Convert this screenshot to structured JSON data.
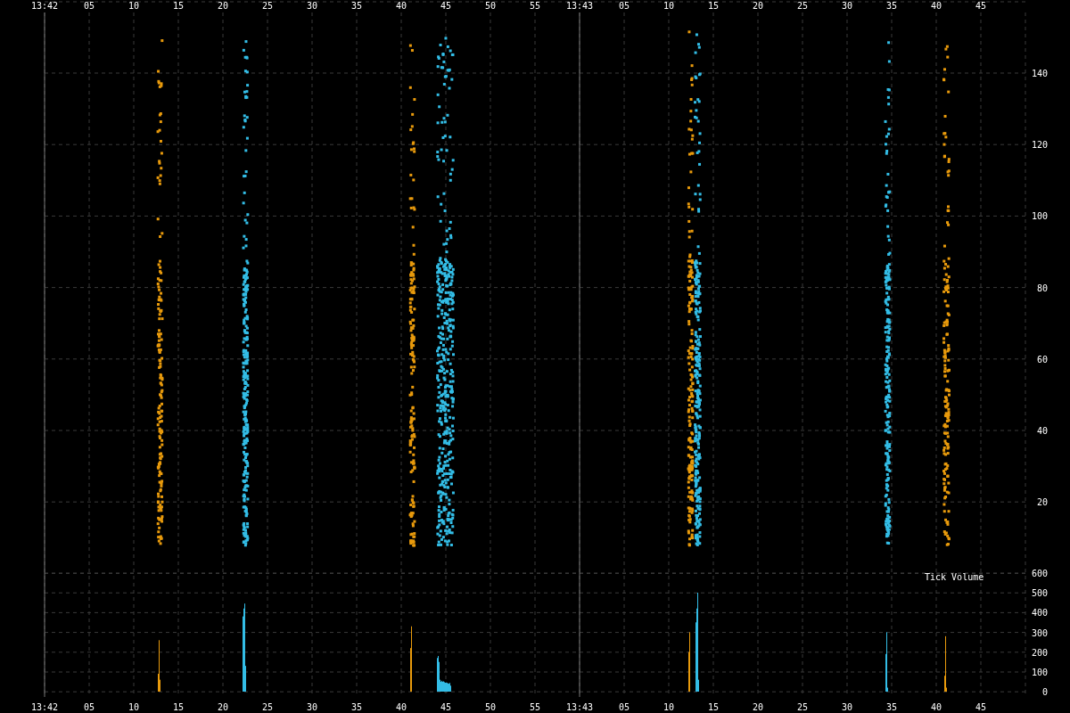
{
  "top_axis": {
    "labels": [
      "13:42",
      "05",
      "10",
      "15",
      "20",
      "25",
      "30",
      "35",
      "40",
      "45",
      "50",
      "55",
      "13:43",
      "05",
      "10",
      "15",
      "20",
      "25",
      "30",
      "35",
      "40",
      "45"
    ]
  },
  "price_axis": {
    "labels": [
      "140",
      "120",
      "100",
      "80",
      "60",
      "40",
      "20"
    ]
  },
  "volume_panel": {
    "title": "Tick Volume"
  },
  "volume_axis": {
    "labels": [
      "600",
      "500",
      "400",
      "300",
      "200",
      "100",
      "0"
    ]
  },
  "bottom_axis": {
    "labels": [
      "13:42",
      "05",
      "10",
      "15",
      "20",
      "25",
      "30",
      "35",
      "40",
      "45",
      "50",
      "55",
      "13:43",
      "05",
      "10",
      "15",
      "20",
      "25",
      "30",
      "35",
      "40",
      "45"
    ]
  }
}
